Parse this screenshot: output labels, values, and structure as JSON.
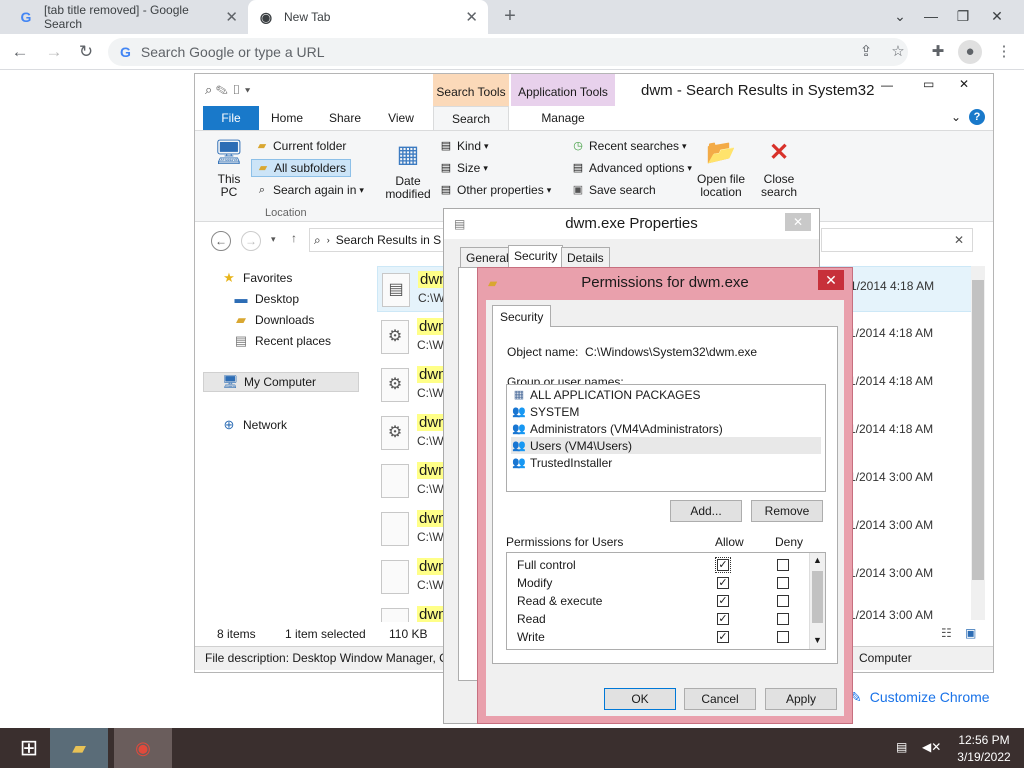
{
  "browser": {
    "tabs": [
      {
        "label": "[tab title removed] - Google Search",
        "icon": "google-icon",
        "active": false
      },
      {
        "label": "New Tab",
        "icon": "chrome-icon",
        "active": true
      }
    ],
    "new_tab_symbol": "+",
    "omnibox_placeholder": "Search Google or type a URL",
    "customize_label": "Customize Chrome"
  },
  "explorer": {
    "title": "dwm - Search Results in System32",
    "context_tabs": [
      "Search Tools",
      "Application Tools"
    ],
    "ribbon_tabs": [
      "File",
      "Home",
      "Share",
      "View",
      "Search",
      "Manage"
    ],
    "ribbon": {
      "this_pc": "This PC",
      "current_folder": "Current folder",
      "all_subfolders": "All subfolders",
      "search_again_in": "Search again in",
      "location_group": "Location",
      "date_modified": "Date modified",
      "kind": "Kind",
      "size": "Size",
      "other_properties": "Other properties",
      "recent_searches": "Recent searches",
      "advanced_options": "Advanced options",
      "save_search": "Save search",
      "open_file_location": "Open file location",
      "close_search": "Close search"
    },
    "address": "Search Results in S",
    "search_close": "✕",
    "nav": {
      "favorites": "Favorites",
      "desktop": "Desktop",
      "downloads": "Downloads",
      "recent_places": "Recent places",
      "my_computer": "My Computer",
      "network": "Network"
    },
    "files": [
      {
        "name": "dwm",
        "path": "C:\\W",
        "date": "1/2014 4:18 AM"
      },
      {
        "name": "dwm",
        "path": "C:\\W",
        "date": "1/2014 4:18 AM"
      },
      {
        "name": "dwm",
        "path": "C:\\W",
        "date": "1/2014 4:18 AM"
      },
      {
        "name": "dwm",
        "path": "C:\\W",
        "date": "1/2014 4:18 AM"
      },
      {
        "name": "dwm",
        "path": "C:\\W",
        "date": "1/2014 3:00 AM"
      },
      {
        "name": "dwm",
        "path": "C:\\W",
        "date": "1/2014 3:00 AM"
      },
      {
        "name": "dwm",
        "path": "C:\\W",
        "date": "1/2014 3:00 AM"
      },
      {
        "name": "dwm",
        "path": "",
        "date": "1/2014 3:00 AM"
      }
    ],
    "status": {
      "items": "8 items",
      "selected": "1 item selected",
      "size": "110 KB"
    },
    "description": "File description: Desktop Window Manager, C",
    "description_right": "Computer"
  },
  "properties": {
    "title": "dwm.exe Properties",
    "tabs": [
      "General",
      "Security",
      "Details"
    ]
  },
  "permissions": {
    "title": "Permissions for dwm.exe",
    "tab": "Security",
    "object_label": "Object name:",
    "object_value": "C:\\Windows\\System32\\dwm.exe",
    "groups_label": "Group or user names:",
    "groups": [
      "ALL APPLICATION PACKAGES",
      "SYSTEM",
      "Administrators (VM4\\Administrators)",
      "Users (VM4\\Users)",
      "TrustedInstaller"
    ],
    "selected_group_index": 3,
    "add_button": "Add...",
    "remove_button": "Remove",
    "perms_label": "Permissions for Users",
    "allow_label": "Allow",
    "deny_label": "Deny",
    "perms": [
      {
        "name": "Full control",
        "allow": true,
        "deny": false
      },
      {
        "name": "Modify",
        "allow": true,
        "deny": false
      },
      {
        "name": "Read & execute",
        "allow": true,
        "deny": false
      },
      {
        "name": "Read",
        "allow": true,
        "deny": false
      },
      {
        "name": "Write",
        "allow": true,
        "deny": false
      }
    ],
    "ok_button": "OK",
    "cancel_button": "Cancel",
    "apply_button": "Apply"
  },
  "taskbar": {
    "time": "12:56 PM",
    "date": "3/19/2022"
  }
}
